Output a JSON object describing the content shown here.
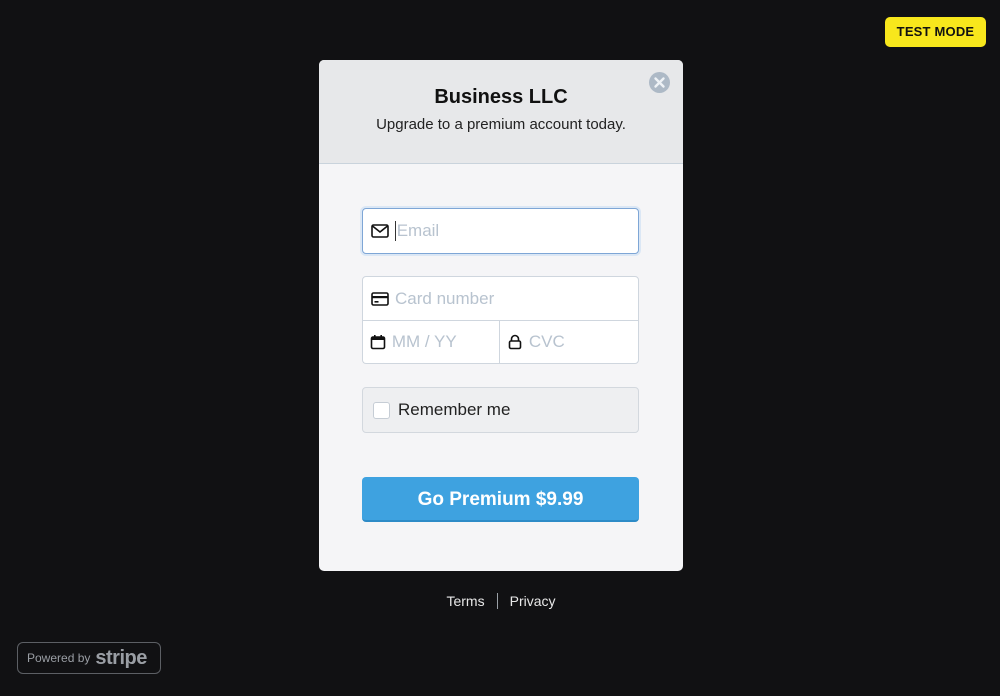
{
  "test_mode_label": "TEST MODE",
  "modal": {
    "title": "Business LLC",
    "subtitle": "Upgrade to a premium account today."
  },
  "form": {
    "email_placeholder": "Email",
    "card_placeholder": "Card number",
    "expiry_placeholder": "MM / YY",
    "cvc_placeholder": "CVC",
    "remember_label": "Remember me",
    "pay_button_label": "Go Premium $9.99"
  },
  "footer": {
    "terms": "Terms",
    "privacy": "Privacy"
  },
  "badge": {
    "powered_by": "Powered by",
    "brand": "stripe"
  },
  "icons": {
    "close": "close-icon",
    "email": "envelope-icon",
    "card": "credit-card-icon",
    "expiry": "calendar-icon",
    "cvc": "lock-icon"
  },
  "colors": {
    "background": "#111113",
    "accent": "#3ea2e0",
    "test_mode": "#f8e71c"
  }
}
